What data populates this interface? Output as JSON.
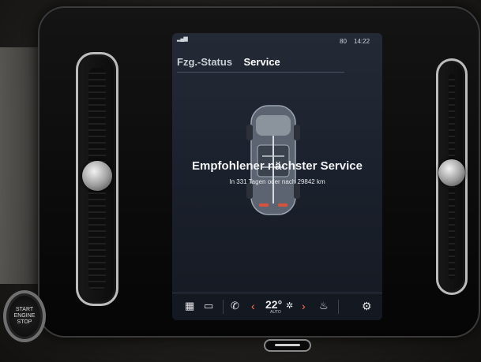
{
  "status_bar": {
    "left_text": "",
    "right_text": "80",
    "time": "14:22"
  },
  "tabs": [
    {
      "label": "Fzg.-Status",
      "active": false
    },
    {
      "label": "Service",
      "active": true
    }
  ],
  "service": {
    "title": "Empfohlener nächster Service",
    "subtitle": "In 331 Tagen oder nach 29842 km"
  },
  "bottom_bar": {
    "temperature": "22°",
    "climate_mode": "AUTO",
    "icons": [
      "grid-icon",
      "camera-icon",
      "phone-icon",
      "chevron-left-icon",
      "fan-icon",
      "chevron-right-icon",
      "seat-heat-icon",
      "gear-icon"
    ]
  },
  "hardware": {
    "engine_button": [
      "START",
      "ENGINE",
      "STOP"
    ]
  },
  "colors": {
    "accent": "#ff7a52",
    "screen_bg": "#1e2430"
  }
}
